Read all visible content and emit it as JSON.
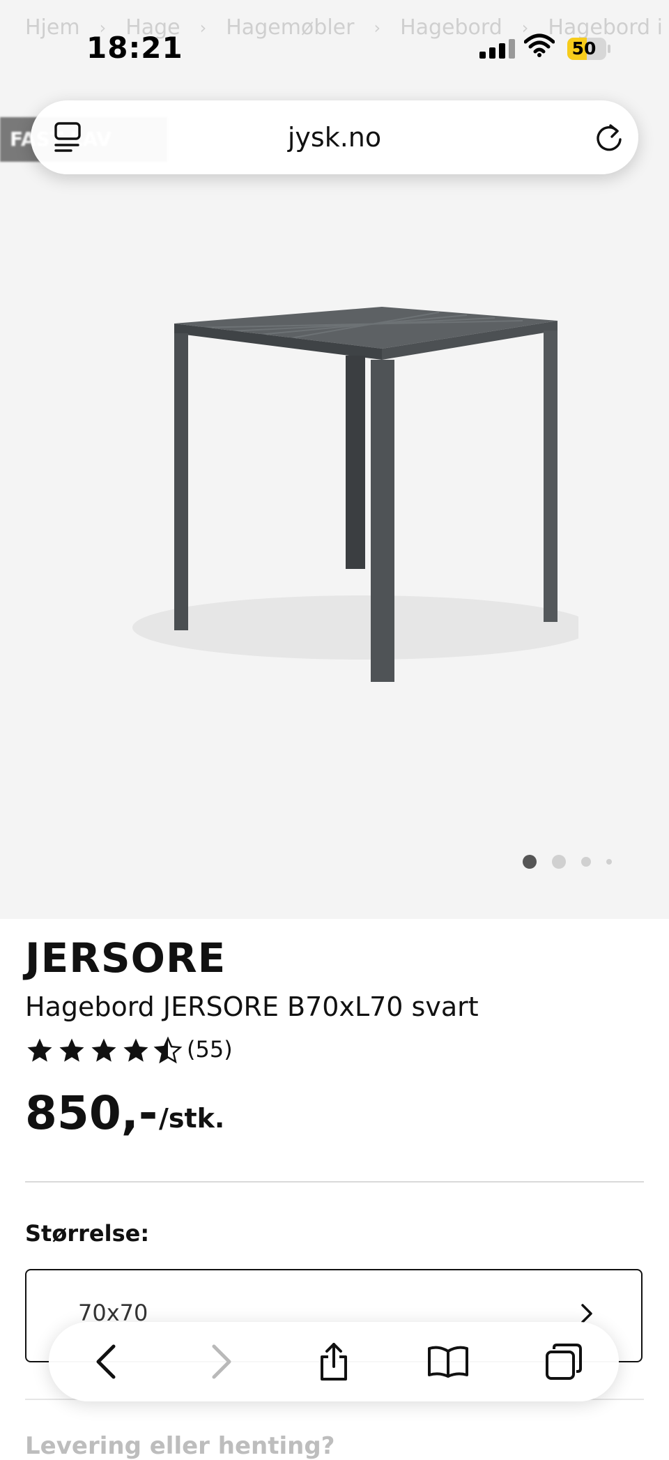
{
  "breadcrumb": [
    "Hjem",
    "Hage",
    "Hagemøbler",
    "Hagebord",
    "Hagebord i artwo"
  ],
  "status_bar": {
    "time": "18:21",
    "battery": "50",
    "battery_level": 0.5
  },
  "badge": {
    "label": "FAST LAV PRIS"
  },
  "browser": {
    "url": "jysk.no"
  },
  "gallery": {
    "count": 4,
    "active": 0
  },
  "product": {
    "brand": "JERSORE",
    "name": "Hagebord JERSORE B70xL70 svart",
    "rating": 4.5,
    "rating_max": 5,
    "review_count": "(55)",
    "price": "850,-",
    "unit": "/stk."
  },
  "size": {
    "label": "Størrelse:",
    "value": "70x70"
  },
  "delivery": {
    "label": "Levering eller henting?"
  },
  "toolbar": {
    "icons": [
      "back-icon",
      "forward-icon",
      "share-icon",
      "bookmarks-icon",
      "tabs-overview-icon"
    ]
  },
  "colors": {
    "battery": "#f7cc1b",
    "table": "#4f5356",
    "hero_bg": "#f4f4f4"
  }
}
